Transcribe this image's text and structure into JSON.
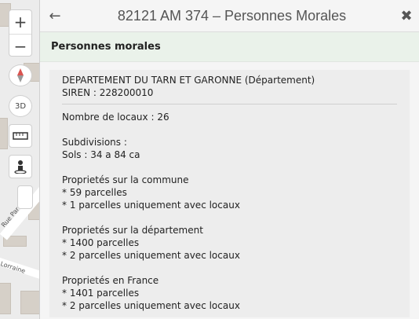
{
  "map": {
    "zoom_in": "+",
    "zoom_out": "−",
    "north_icon": "compass-arrow-icon",
    "threed_label": "3D",
    "road_labels": [
      "Rue Par",
      "Lorraine"
    ]
  },
  "panel": {
    "title": "82121 AM 374 – Personnes Morales",
    "back_icon": "←",
    "close_icon": "✖",
    "section_title": "Personnes morales",
    "owner": {
      "name": "DEPARTEMENT DU TARN ET GARONNE (Département)",
      "siren": "SIREN : 228200010"
    },
    "locaux": "Nombre de locaux : 26",
    "subdivisions": {
      "label": "Subdivisions :",
      "value": "Sols : 34 a 84 ca"
    },
    "commune": {
      "label": "Proprietés sur la commune",
      "parcelles": "* 59 parcelles",
      "avec_locaux": "* 1 parcelles uniquement avec locaux"
    },
    "departement": {
      "label": "Proprietés sur la département",
      "parcelles": "* 1400 parcelles",
      "avec_locaux": "* 2 parcelles uniquement avec locaux"
    },
    "france": {
      "label": "Proprietés en France",
      "parcelles": "* 1401 parcelles",
      "avec_locaux": "* 2 parcelles uniquement avec locaux"
    }
  }
}
